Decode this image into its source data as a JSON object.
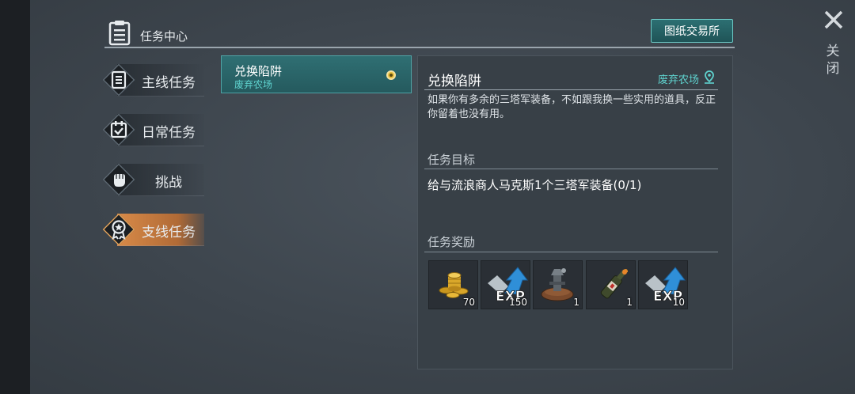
{
  "header": {
    "title": "任务中心",
    "trade_button": "图纸交易所"
  },
  "close": {
    "label": "关闭"
  },
  "tabs": [
    {
      "label": "主线任务",
      "icon": "scroll-list-icon",
      "active": false
    },
    {
      "label": "日常任务",
      "icon": "calendar-check-icon",
      "active": false
    },
    {
      "label": "挑战",
      "icon": "fist-icon",
      "active": false
    },
    {
      "label": "支线任务",
      "icon": "medal-star-icon",
      "active": true
    }
  ],
  "quests": [
    {
      "name": "兑换陷阱",
      "location": "废弃农场",
      "selected": true
    }
  ],
  "detail": {
    "title": "兑换陷阱",
    "location": "废弃农场",
    "description": "如果你有多余的三塔军装备，不如跟我换一些实用的道具，反正你留着也没有用。",
    "goal_title": "任务目标",
    "goal": "给与流浪商人马克斯1个三塔军装备(0/1)",
    "reward_title": "任务奖励",
    "rewards": [
      {
        "icon": "gold-coins-icon",
        "count": "70"
      },
      {
        "icon": "exp-arrow-icon",
        "count": "150"
      },
      {
        "icon": "trap-device-icon",
        "count": "1"
      },
      {
        "icon": "molotov-bottle-icon",
        "count": "1"
      },
      {
        "icon": "exp-arrow-icon",
        "count": "10"
      }
    ]
  },
  "colors": {
    "accent_teal": "#2f6f73",
    "active_tab": "#d88a48",
    "location_text": "#5fd3cf"
  }
}
